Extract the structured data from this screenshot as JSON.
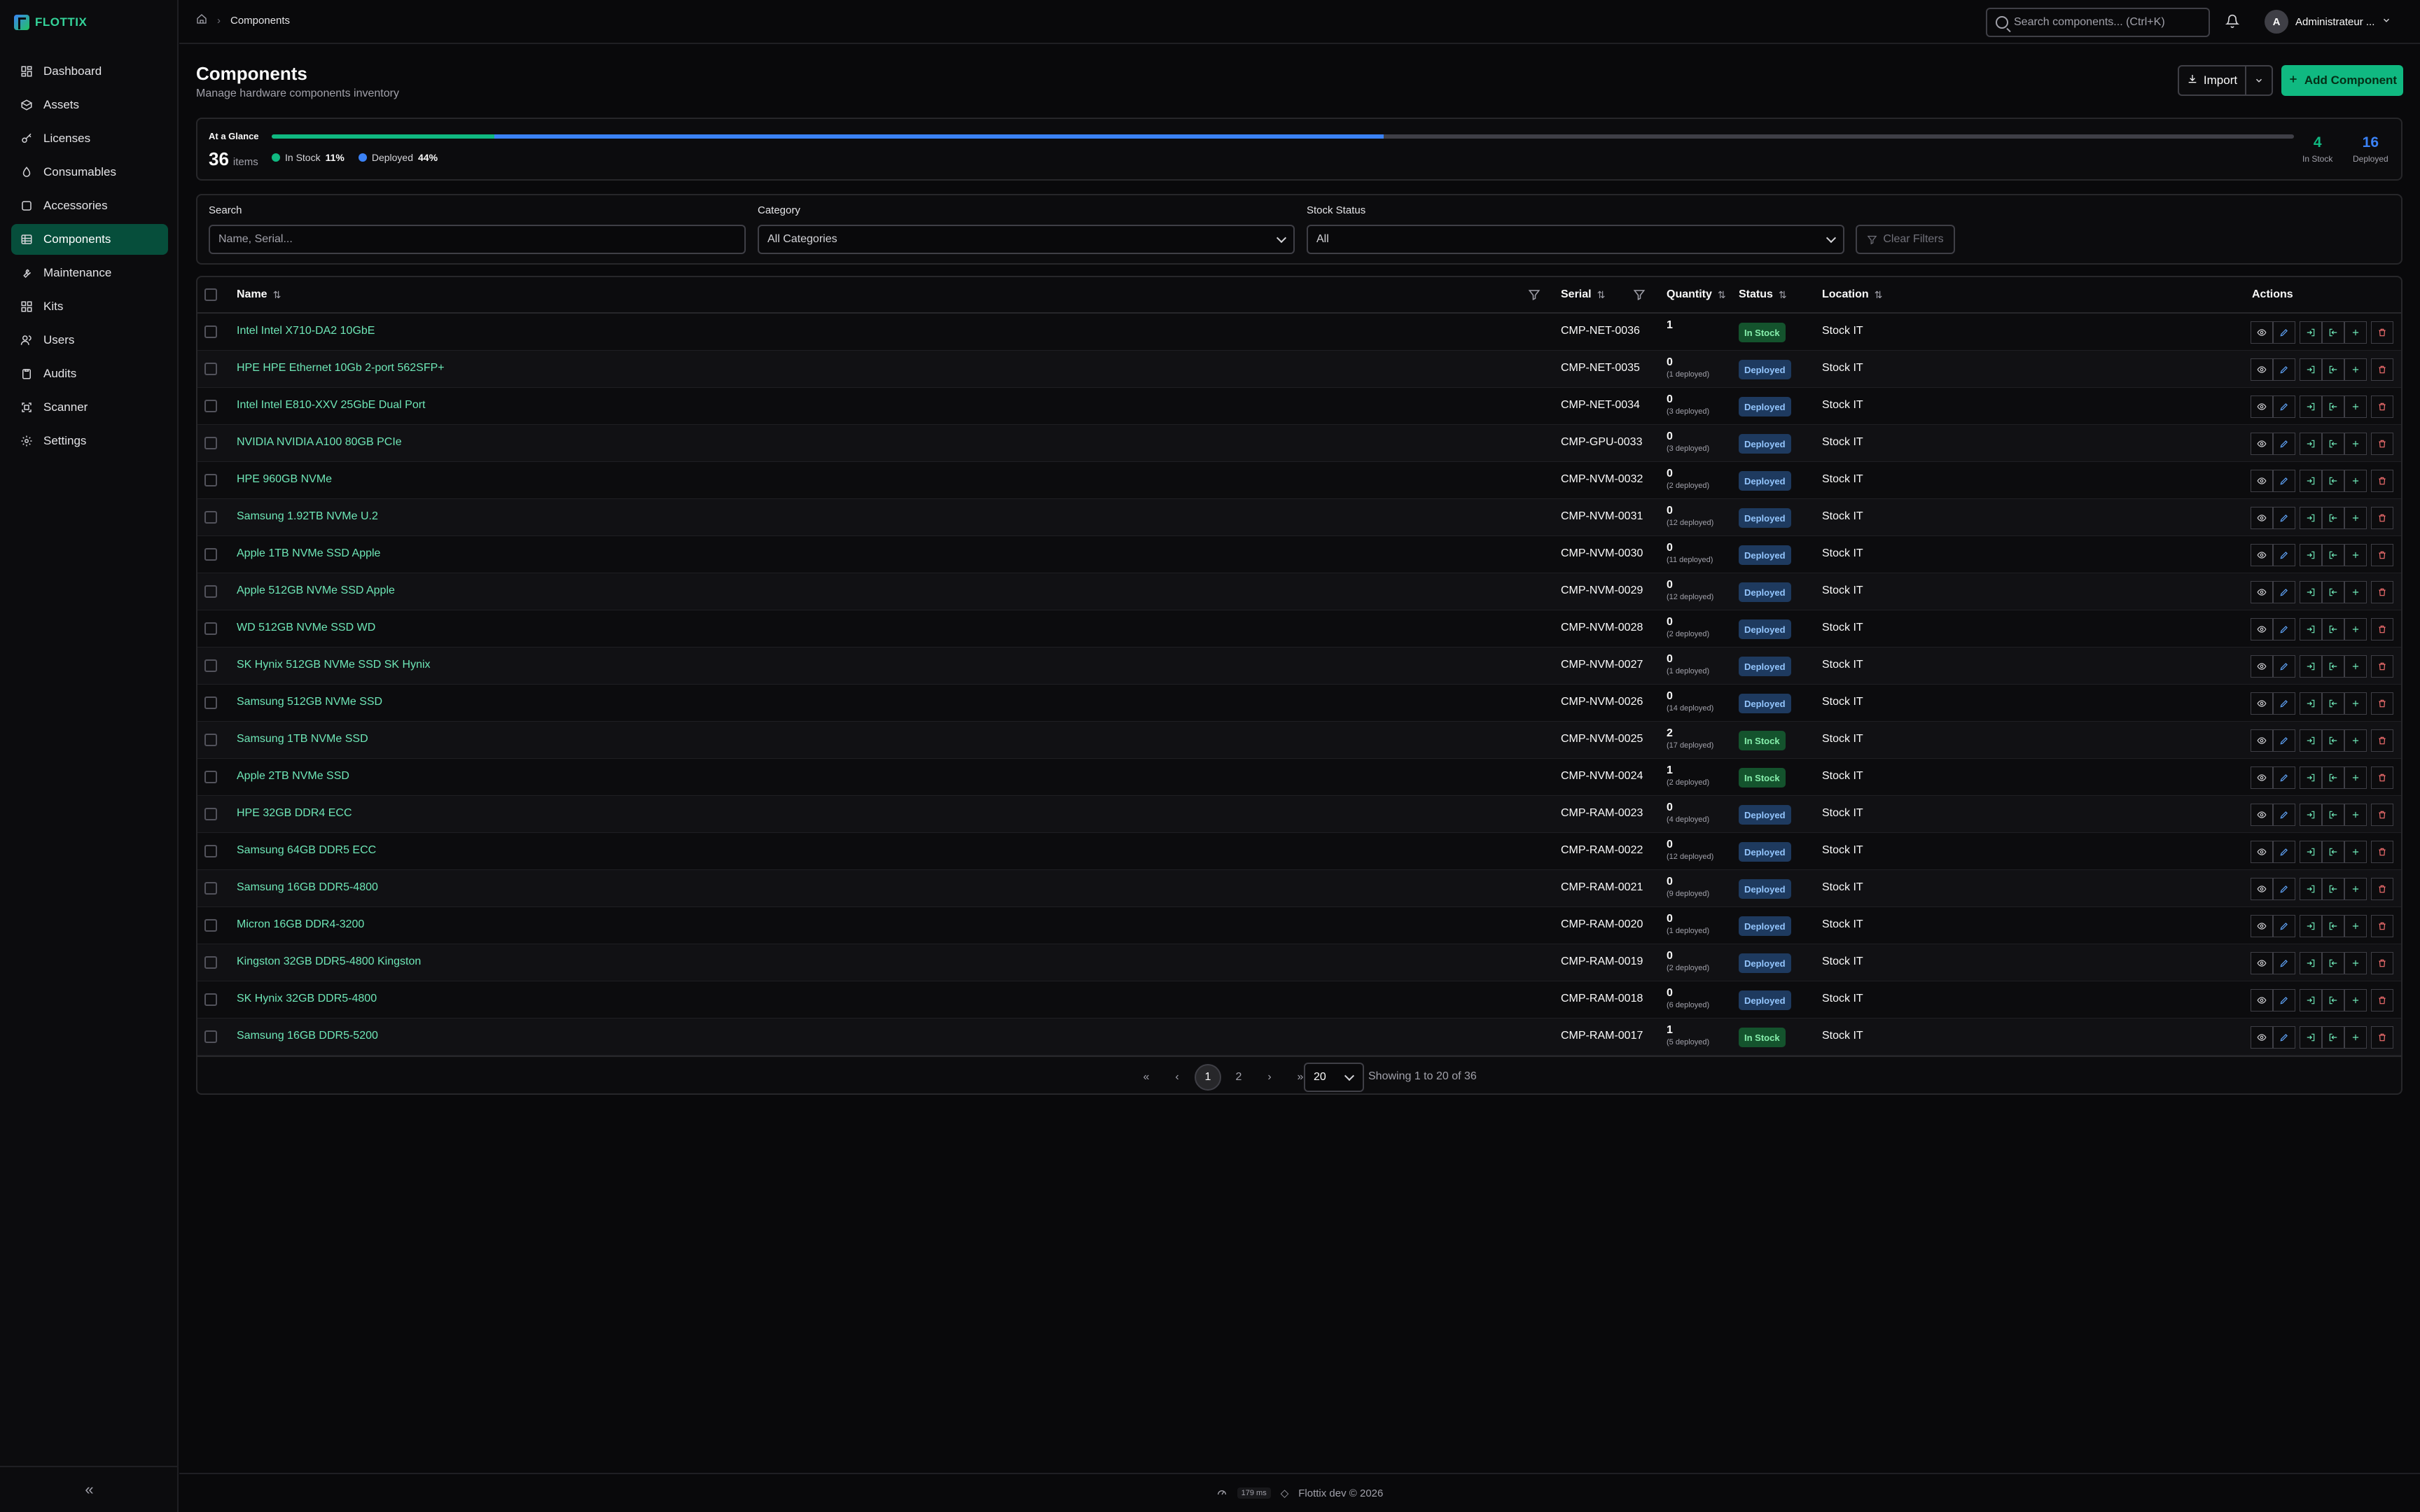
{
  "brand": "FLOTTIX",
  "sidebar": {
    "items": [
      {
        "label": "Dashboard",
        "icon": "dashboard-icon"
      },
      {
        "label": "Assets",
        "icon": "box-icon"
      },
      {
        "label": "Licenses",
        "icon": "key-icon"
      },
      {
        "label": "Consumables",
        "icon": "droplet-icon"
      },
      {
        "label": "Accessories",
        "icon": "keyboard-icon"
      },
      {
        "label": "Components",
        "icon": "cpu-icon",
        "active": true
      },
      {
        "label": "Maintenance",
        "icon": "wrench-icon"
      },
      {
        "label": "Kits",
        "icon": "grid-icon"
      },
      {
        "label": "Users",
        "icon": "users-icon"
      },
      {
        "label": "Audits",
        "icon": "clipboard-icon"
      },
      {
        "label": "Scanner",
        "icon": "scan-icon"
      },
      {
        "label": "Settings",
        "icon": "gear-icon"
      }
    ],
    "collapse_label": "«"
  },
  "topbar": {
    "breadcrumb": "Components",
    "search_placeholder": "Search components... (Ctrl+K)",
    "user_initial": "A",
    "user_name": "Administrateur ..."
  },
  "header": {
    "title": "Components",
    "subtitle": "Manage hardware components inventory",
    "import_label": "Import",
    "add_label": "Add Component"
  },
  "glance": {
    "label": "At a Glance",
    "count": "36",
    "count_unit": "items",
    "in_stock_label": "In Stock",
    "in_stock_pct": "11%",
    "in_stock_fraction": 0.11,
    "deployed_label": "Deployed",
    "deployed_pct": "44%",
    "deployed_fraction": 0.44,
    "stat_in_stock_value": "4",
    "stat_in_stock_label": "In Stock",
    "stat_deployed_value": "16",
    "stat_deployed_label": "Deployed",
    "colors": {
      "in_stock": "#10b981",
      "deployed": "#3b82f6"
    }
  },
  "filters": {
    "search_label": "Search",
    "search_placeholder": "Name, Serial...",
    "category_label": "Category",
    "category_value": "All Categories",
    "stock_label": "Stock Status",
    "stock_value": "All",
    "clear_label": "Clear Filters"
  },
  "table": {
    "columns": {
      "name": "Name",
      "serial": "Serial",
      "quantity": "Quantity",
      "status": "Status",
      "location": "Location",
      "actions": "Actions"
    },
    "rows": [
      {
        "name": "Intel Intel X710-DA2 10GbE",
        "serial": "CMP-NET-0036",
        "qty": "1",
        "deployed": "",
        "status": "In Stock",
        "location": "Stock IT"
      },
      {
        "name": "HPE HPE Ethernet 10Gb 2-port 562SFP+",
        "serial": "CMP-NET-0035",
        "qty": "0",
        "deployed": "(1 deployed)",
        "status": "Deployed",
        "location": "Stock IT"
      },
      {
        "name": "Intel Intel E810-XXV 25GbE Dual Port",
        "serial": "CMP-NET-0034",
        "qty": "0",
        "deployed": "(3 deployed)",
        "status": "Deployed",
        "location": "Stock IT"
      },
      {
        "name": "NVIDIA NVIDIA A100 80GB PCIe",
        "serial": "CMP-GPU-0033",
        "qty": "0",
        "deployed": "(3 deployed)",
        "status": "Deployed",
        "location": "Stock IT"
      },
      {
        "name": "HPE 960GB NVMe",
        "serial": "CMP-NVM-0032",
        "qty": "0",
        "deployed": "(2 deployed)",
        "status": "Deployed",
        "location": "Stock IT"
      },
      {
        "name": "Samsung 1.92TB NVMe U.2",
        "serial": "CMP-NVM-0031",
        "qty": "0",
        "deployed": "(12 deployed)",
        "status": "Deployed",
        "location": "Stock IT"
      },
      {
        "name": "Apple 1TB NVMe SSD Apple",
        "serial": "CMP-NVM-0030",
        "qty": "0",
        "deployed": "(11 deployed)",
        "status": "Deployed",
        "location": "Stock IT"
      },
      {
        "name": "Apple 512GB NVMe SSD Apple",
        "serial": "CMP-NVM-0029",
        "qty": "0",
        "deployed": "(12 deployed)",
        "status": "Deployed",
        "location": "Stock IT"
      },
      {
        "name": "WD 512GB NVMe SSD WD",
        "serial": "CMP-NVM-0028",
        "qty": "0",
        "deployed": "(2 deployed)",
        "status": "Deployed",
        "location": "Stock IT"
      },
      {
        "name": "SK Hynix 512GB NVMe SSD SK Hynix",
        "serial": "CMP-NVM-0027",
        "qty": "0",
        "deployed": "(1 deployed)",
        "status": "Deployed",
        "location": "Stock IT"
      },
      {
        "name": "Samsung 512GB NVMe SSD",
        "serial": "CMP-NVM-0026",
        "qty": "0",
        "deployed": "(14 deployed)",
        "status": "Deployed",
        "location": "Stock IT"
      },
      {
        "name": "Samsung 1TB NVMe SSD",
        "serial": "CMP-NVM-0025",
        "qty": "2",
        "deployed": "(17 deployed)",
        "status": "In Stock",
        "location": "Stock IT"
      },
      {
        "name": "Apple 2TB NVMe SSD",
        "serial": "CMP-NVM-0024",
        "qty": "1",
        "deployed": "(2 deployed)",
        "status": "In Stock",
        "location": "Stock IT"
      },
      {
        "name": "HPE 32GB DDR4 ECC",
        "serial": "CMP-RAM-0023",
        "qty": "0",
        "deployed": "(4 deployed)",
        "status": "Deployed",
        "location": "Stock IT"
      },
      {
        "name": "Samsung 64GB DDR5 ECC",
        "serial": "CMP-RAM-0022",
        "qty": "0",
        "deployed": "(12 deployed)",
        "status": "Deployed",
        "location": "Stock IT"
      },
      {
        "name": "Samsung 16GB DDR5-4800",
        "serial": "CMP-RAM-0021",
        "qty": "0",
        "deployed": "(9 deployed)",
        "status": "Deployed",
        "location": "Stock IT"
      },
      {
        "name": "Micron 16GB DDR4-3200",
        "serial": "CMP-RAM-0020",
        "qty": "0",
        "deployed": "(1 deployed)",
        "status": "Deployed",
        "location": "Stock IT"
      },
      {
        "name": "Kingston 32GB DDR5-4800 Kingston",
        "serial": "CMP-RAM-0019",
        "qty": "0",
        "deployed": "(2 deployed)",
        "status": "Deployed",
        "location": "Stock IT"
      },
      {
        "name": "SK Hynix 32GB DDR5-4800",
        "serial": "CMP-RAM-0018",
        "qty": "0",
        "deployed": "(6 deployed)",
        "status": "Deployed",
        "location": "Stock IT"
      },
      {
        "name": "Samsung 16GB DDR5-5200",
        "serial": "CMP-RAM-0017",
        "qty": "1",
        "deployed": "(5 deployed)",
        "status": "In Stock",
        "location": "Stock IT"
      }
    ]
  },
  "pagination": {
    "pages": [
      "1",
      "2"
    ],
    "current": "1",
    "per_page": "20",
    "showing": "Showing 1 to 20 of 36"
  },
  "footer": {
    "ms": "179 ms",
    "copyright": "Flottix dev © 2026"
  }
}
